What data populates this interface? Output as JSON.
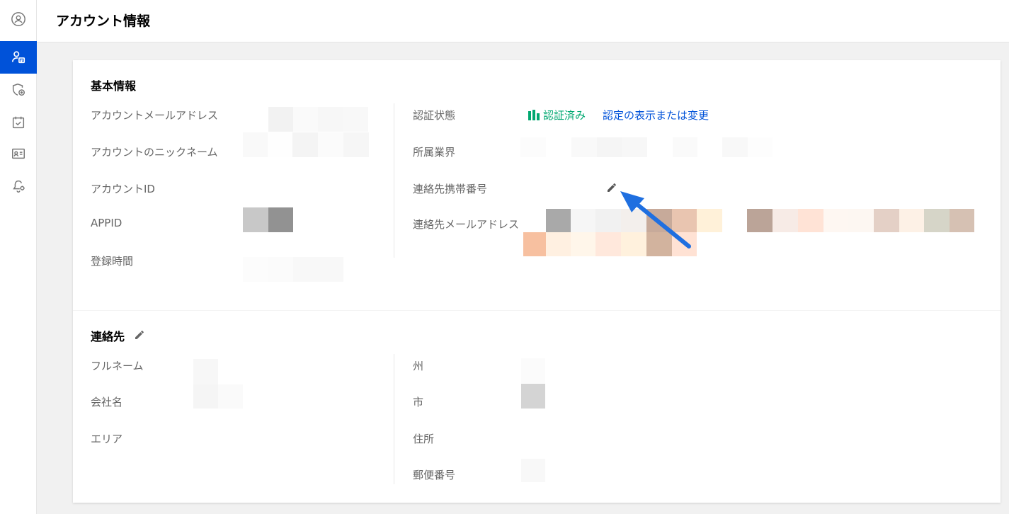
{
  "page": {
    "title": "アカウント情報"
  },
  "sidebar": {
    "items": [
      {
        "name": "profile-circle-icon",
        "active": false
      },
      {
        "name": "account-info-icon",
        "active": true
      },
      {
        "name": "shield-add-icon",
        "active": false
      },
      {
        "name": "checklist-icon",
        "active": false
      },
      {
        "name": "id-card-icon",
        "active": false
      },
      {
        "name": "bell-gear-icon",
        "active": false
      }
    ]
  },
  "basic": {
    "title": "基本情報",
    "labels": {
      "email": "アカウントメールアドレス",
      "nickname": "アカウントのニックネーム",
      "account_id": "アカウントID",
      "appid": "APPID",
      "registered": "登録時間",
      "verification": "認証状態",
      "industry": "所属業界",
      "mobile": "連絡先携帯番号",
      "contact_email": "連絡先メールアドレス"
    },
    "verification": {
      "status": "認証済み",
      "link": "認定の表示または変更"
    }
  },
  "contact": {
    "title": "連絡先",
    "labels": {
      "fullname": "フルネーム",
      "company": "会社名",
      "area": "エリア",
      "state": "州",
      "city": "市",
      "address": "住所",
      "zip": "郵便番号"
    }
  },
  "colors": {
    "accent": "#0052d9",
    "verified": "#00a870",
    "annotation_arrow": "#1f6fe0"
  }
}
